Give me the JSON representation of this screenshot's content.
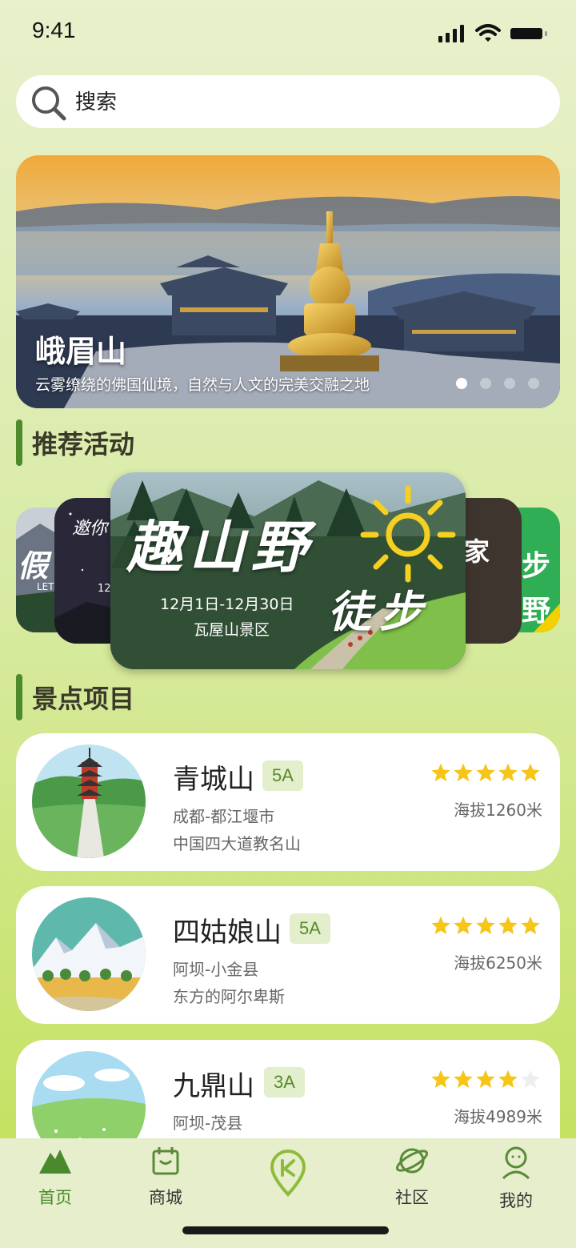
{
  "status_bar": {
    "time": "9:41"
  },
  "search": {
    "placeholder": "搜索"
  },
  "banner": {
    "title": "峨眉山",
    "subtitle": "云雾缭绕的佛国仙境，自然与人文的完美交融之地",
    "page_count": 4,
    "active_index": 0
  },
  "sections": {
    "activities": "推荐活动",
    "spots": "景点项目"
  },
  "activities": {
    "featured": {
      "title_main": "趣山野",
      "title_sub": "徒步",
      "dates": "12月1日-12月30日",
      "place": "瓦屋山景区"
    },
    "left_outer_text": "假",
    "left_outer_small": "LET'",
    "left_inner_text": "邀你",
    "left_inner_small": "12.",
    "right_inner_text": "家",
    "right_outer_text": "步",
    "right_outer_text2": "野"
  },
  "spots": [
    {
      "name": "青城山",
      "grade": "5A",
      "location": "成都-都江堰市",
      "description": "中国四大道教名山",
      "rating": 5,
      "altitude": "海拔1260米"
    },
    {
      "name": "四姑娘山",
      "grade": "5A",
      "location": "阿坝-小金县",
      "description": "东方的阿尔卑斯",
      "rating": 5,
      "altitude": "海拔6250米"
    },
    {
      "name": "九鼎山",
      "grade": "3A",
      "location": "阿坝-茂县",
      "description": "",
      "rating": 4,
      "altitude": "海拔4989米"
    }
  ],
  "tabs": [
    {
      "label": "首页",
      "icon": "mountain-icon",
      "active": true
    },
    {
      "label": "商城",
      "icon": "shop-bag-icon",
      "active": false
    },
    {
      "label": "",
      "icon": "location-pin-icon",
      "active": false
    },
    {
      "label": "社区",
      "icon": "planet-icon",
      "active": false
    },
    {
      "label": "我的",
      "icon": "user-icon",
      "active": false
    }
  ],
  "colors": {
    "accent": "#4c8a2c",
    "badge_bg": "#e2eecc",
    "star": "#f5c518",
    "star_empty": "#eeeeee",
    "tabbar_bg": "#e6eecb"
  }
}
